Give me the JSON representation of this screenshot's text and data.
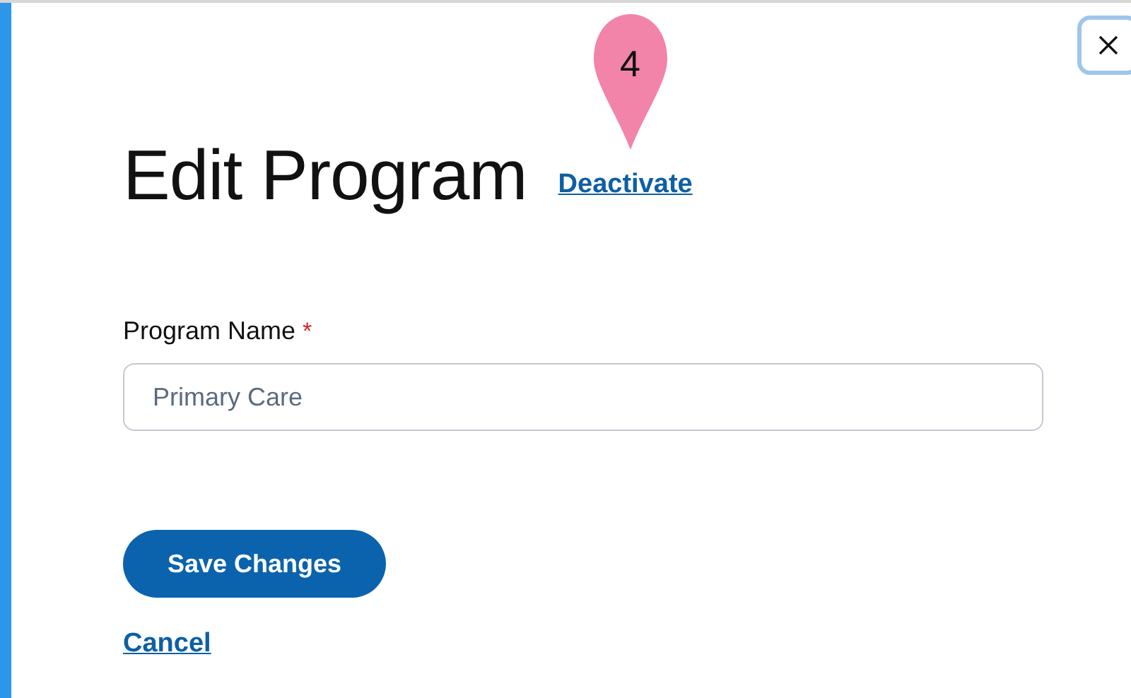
{
  "dialog": {
    "title": "Edit Program",
    "title_link": "Deactivate",
    "callout": {
      "label": "4"
    },
    "field": {
      "label": "Program Name",
      "required": true,
      "required_mark": "*",
      "value": "Primary Care"
    },
    "primary_button": "Save Changes",
    "cancel_link": "Cancel"
  }
}
